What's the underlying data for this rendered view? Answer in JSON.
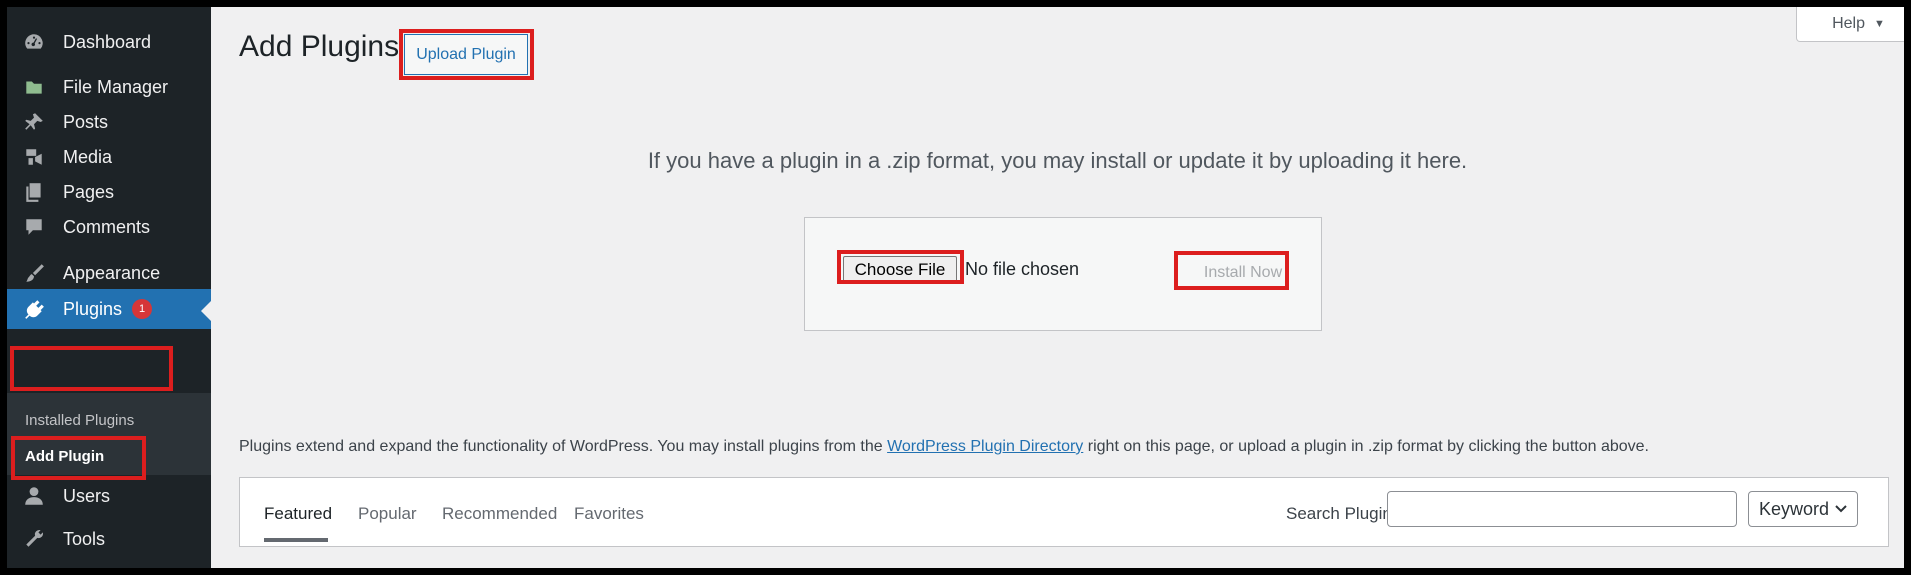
{
  "sidebar": {
    "items": [
      {
        "label": "Dashboard",
        "icon": "dashboard-icon"
      },
      {
        "label": "File Manager",
        "icon": "folder-icon"
      },
      {
        "label": "Posts",
        "icon": "pushpin-icon"
      },
      {
        "label": "Media",
        "icon": "media-icon"
      },
      {
        "label": "Pages",
        "icon": "pages-icon"
      },
      {
        "label": "Comments",
        "icon": "comment-icon"
      },
      {
        "label": "Appearance",
        "icon": "paintbrush-icon"
      },
      {
        "label": "Plugins",
        "icon": "plugin-icon",
        "badge": "1",
        "active": true
      },
      {
        "label": "Users",
        "icon": "user-icon"
      },
      {
        "label": "Tools",
        "icon": "wrench-icon"
      }
    ],
    "submenu": [
      {
        "label": "Installed Plugins"
      },
      {
        "label": "Add Plugin",
        "current": true
      }
    ]
  },
  "header": {
    "title": "Add Plugins",
    "upload_label": "Upload Plugin",
    "help_label": "Help"
  },
  "upload": {
    "intro": "If you have a plugin in a .zip format, you may install or update it by uploading it here.",
    "choose_label": "Choose File",
    "no_file": "No file chosen",
    "install_label": "Install Now"
  },
  "description": {
    "before": "Plugins extend and expand the functionality of WordPress. You may install plugins from the",
    "link": "WordPress Plugin Directory",
    "after": "right on this page, or upload a plugin in .zip format by clicking the button above."
  },
  "filter": {
    "tabs": [
      "Featured",
      "Popular",
      "Recommended",
      "Favorites"
    ],
    "current_tab": "Featured",
    "search_label": "Search Plugins",
    "search_value": "",
    "select_value": "Keyword"
  },
  "colors": {
    "sidebar_bg": "#1d2327",
    "active_bg": "#2271b1",
    "highlight": "#dc1e1e",
    "badge": "#d63638"
  }
}
